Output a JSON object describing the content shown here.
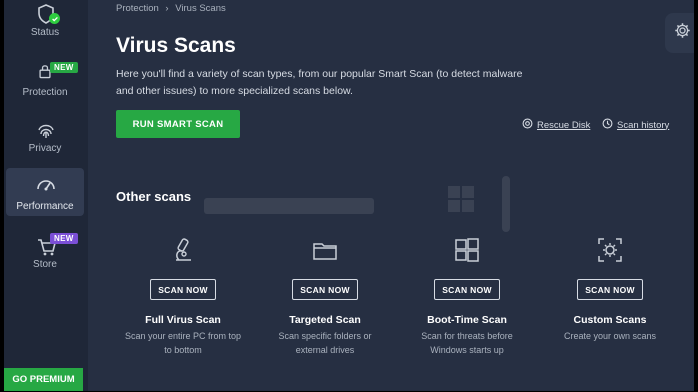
{
  "sidebar": {
    "items": [
      {
        "label": "Status",
        "icon": "shield-check-icon"
      },
      {
        "label": "Protection",
        "icon": "lock-icon",
        "badge": "NEW",
        "badge_color": "#27a844"
      },
      {
        "label": "Privacy",
        "icon": "fingerprint-icon"
      },
      {
        "label": "Performance",
        "icon": "speedometer-icon",
        "active": true
      },
      {
        "label": "Store",
        "icon": "cart-icon",
        "badge": "NEW",
        "badge_color": "#7b4fd6"
      }
    ],
    "premium_label": "GO PREMIUM"
  },
  "breadcrumb": {
    "parent": "Protection",
    "separator": "›",
    "current": "Virus Scans"
  },
  "header": {
    "title": "Virus Scans",
    "description": "Here you'll find a variety of scan types, from our popular Smart Scan (to detect malware and other issues) to more specialized scans below."
  },
  "actions": {
    "run_smart_scan": "RUN SMART SCAN",
    "rescue_disk": "Rescue Disk",
    "scan_history": "Scan history"
  },
  "other_scans": {
    "title": "Other scans",
    "cards": [
      {
        "icon": "microscope-icon",
        "button": "SCAN NOW",
        "title": "Full Virus Scan",
        "desc": "Scan your entire PC from top to bottom"
      },
      {
        "icon": "folder-icon",
        "button": "SCAN NOW",
        "title": "Targeted Scan",
        "desc": "Scan specific folders or external drives"
      },
      {
        "icon": "windows-icon",
        "button": "SCAN NOW",
        "title": "Boot-Time Scan",
        "desc": "Scan for threats before Windows starts up"
      },
      {
        "icon": "custom-scan-icon",
        "button": "SCAN NOW",
        "title": "Custom Scans",
        "desc": "Create your own scans"
      }
    ]
  },
  "colors": {
    "accent_green": "#27a844",
    "background": "#262f42",
    "sidebar": "#1f2738"
  }
}
